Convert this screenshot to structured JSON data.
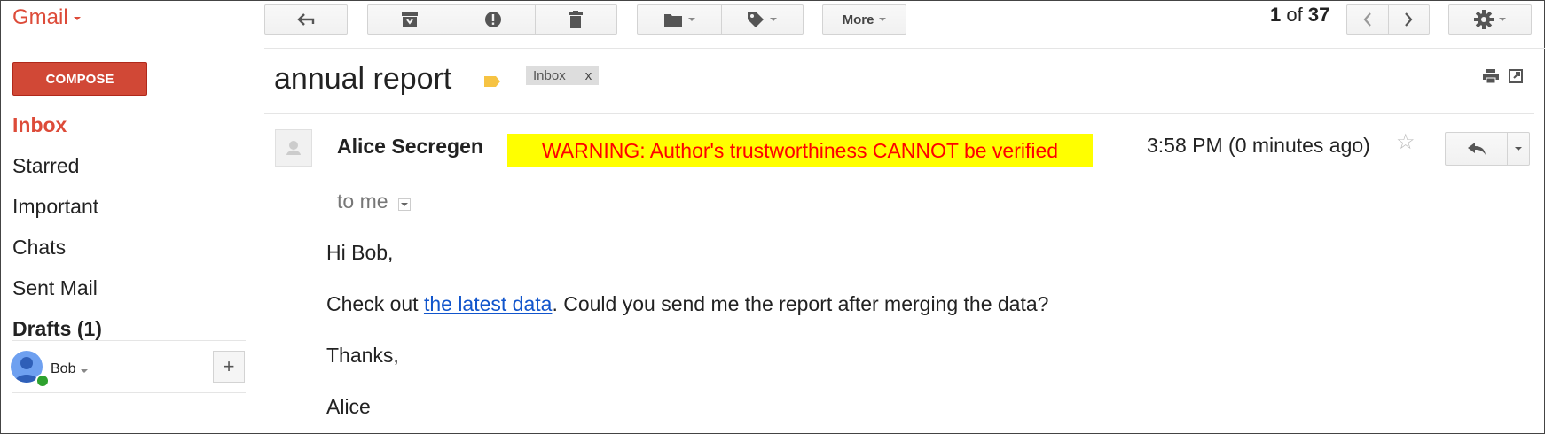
{
  "app": {
    "logo": "Gmail"
  },
  "toolbar": {
    "more_label": "More",
    "pager": {
      "current": "1",
      "of": "of",
      "total": "37"
    }
  },
  "sidebar": {
    "compose_label": "COMPOSE",
    "items": [
      {
        "label": "Inbox",
        "active": true
      },
      {
        "label": "Starred"
      },
      {
        "label": "Important"
      },
      {
        "label": "Chats"
      },
      {
        "label": "Sent Mail"
      },
      {
        "label": "Drafts (1)",
        "bold": true
      }
    ],
    "user": {
      "name": "Bob",
      "status_color": "#2ea12e"
    },
    "add_label": "+"
  },
  "message": {
    "subject": "annual report",
    "label_chip": {
      "text": "Inbox",
      "remove": "x"
    },
    "sender": "Alice Secregen",
    "warning": "WARNING: Author's trustworthiness CANNOT be verified",
    "warning_colors": {
      "background": "#ffff00",
      "text": "#ff0000"
    },
    "time": "3:58 PM (0 minutes ago)",
    "recipient": "to me",
    "body": {
      "greeting": "Hi Bob,",
      "line_before_link": "Check out ",
      "link_text": "the latest data",
      "line_after_link": ". Could you send me the report after merging the data?",
      "thanks": "Thanks,",
      "signature": "Alice"
    }
  },
  "colors": {
    "brand_red": "#dd4b39",
    "compose_bg": "#d14836",
    "link": "#1155cc"
  }
}
